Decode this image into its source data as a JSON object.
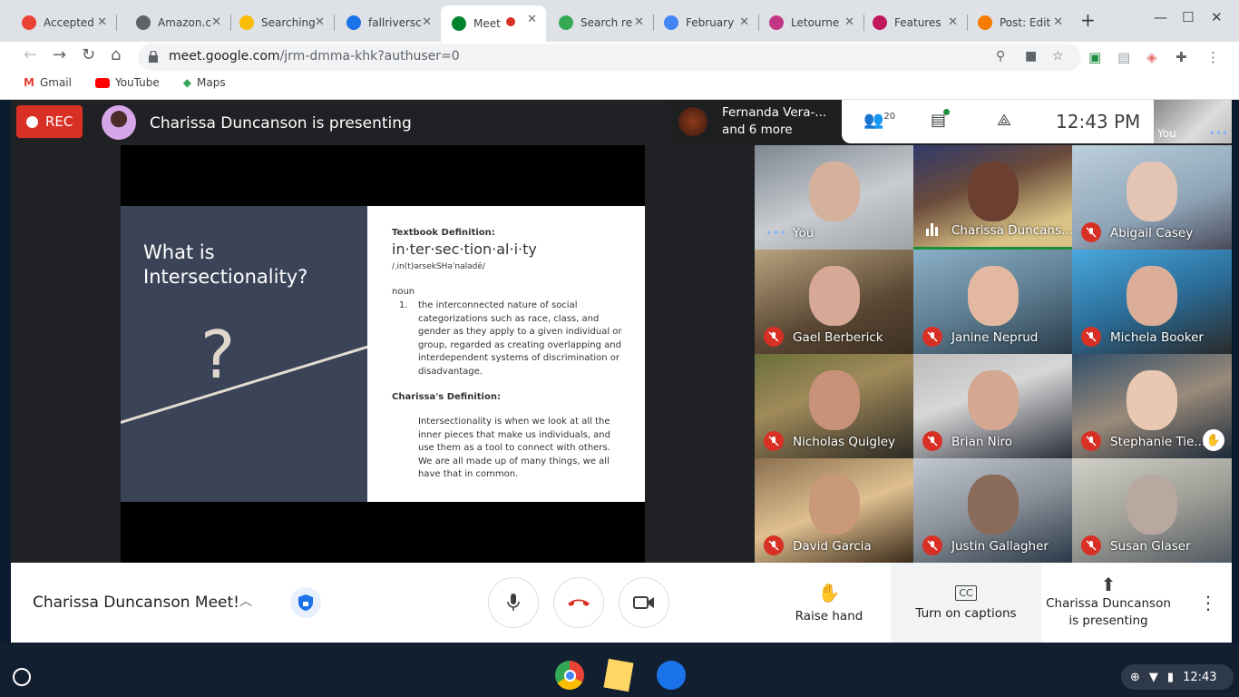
{
  "browser": {
    "tabs": [
      {
        "title": "Accepted",
        "icon": "gmail-icon",
        "color": "#ea4335"
      },
      {
        "title": "Amazon.c",
        "icon": "globe-icon",
        "color": "#5f6368"
      },
      {
        "title": "Searching",
        "icon": "google-photos-icon",
        "color": "#fbbc04"
      },
      {
        "title": "fallriversc",
        "icon": "sheets-icon",
        "color": "#1a73e8"
      },
      {
        "title": "Meet",
        "icon": "meet-icon",
        "color": "#00832d"
      },
      {
        "title": "Search re",
        "icon": "drive-icon",
        "color": "#34a853"
      },
      {
        "title": "February",
        "icon": "docs-icon",
        "color": "#4285f4"
      },
      {
        "title": "Letourne",
        "icon": "instagram-icon",
        "color": "#c13584"
      },
      {
        "title": "Features",
        "icon": "bird-icon",
        "color": "#c2185b"
      },
      {
        "title": "Post: Edit",
        "icon": "blogger-icon",
        "color": "#f57c00"
      }
    ],
    "url_host": "meet.google.com",
    "url_path": "/jrm-dmma-khk?authuser=0",
    "bookmarks": [
      {
        "label": "Gmail",
        "icon": "gmail-icon"
      },
      {
        "label": "YouTube",
        "icon": "youtube-icon"
      },
      {
        "label": "Maps",
        "icon": "maps-icon"
      }
    ]
  },
  "meet": {
    "rec_label": "REC",
    "presenting_text": "Charissa Duncanson is presenting",
    "overflow_line1": "Fernanda Vera-...",
    "overflow_line2": "and 6 more",
    "participant_count": "20",
    "time": "12:43  PM",
    "self_label": "You",
    "slide": {
      "title": "What is Intersectionality?",
      "question_mark": "?",
      "textbook_heading": "Textbook Definition:",
      "word": "in·ter·sec·tion·al·i·ty",
      "phonetic": "/ˌin(t)ərsekSHəˈnalədē/",
      "pos": "noun",
      "def_number": "1.",
      "definition": "the interconnected nature of social categorizations such as race, class, and gender as they apply to a given individual or group, regarded as creating overlapping and interdependent systems of discrimination or disadvantage.",
      "custom_heading": "Charissa's Definition:",
      "custom_definition": "Intersectionality is when we look at all the inner pieces that make us individuals, and use them as a tool to connect with others. We are all made up of many things, we all have that in common."
    },
    "participants": [
      {
        "name": "You",
        "muted": false,
        "state": "dots"
      },
      {
        "name": "Charissa Duncans...",
        "muted": false,
        "state": "speaking"
      },
      {
        "name": "Abigail Casey",
        "muted": true
      },
      {
        "name": "Gael Berberick",
        "muted": true
      },
      {
        "name": "Janine Neprud",
        "muted": true
      },
      {
        "name": "Michela Booker",
        "muted": true
      },
      {
        "name": "Nicholas Quigley",
        "muted": true
      },
      {
        "name": "Brian Niro",
        "muted": true
      },
      {
        "name": "Stephanie Tie...",
        "muted": true,
        "hand_raised": true
      },
      {
        "name": "David Garcia",
        "muted": true
      },
      {
        "name": "Justin Gallagher",
        "muted": true
      },
      {
        "name": "Susan Glaser",
        "muted": true
      }
    ],
    "meeting_name": "Charissa Duncanson Meet!",
    "raise_hand_label": "Raise hand",
    "captions_label": "Turn on captions",
    "presenting_label_1": "Charissa Duncanson",
    "presenting_label_2": "is presenting"
  },
  "shelf": {
    "time": "12:43"
  }
}
